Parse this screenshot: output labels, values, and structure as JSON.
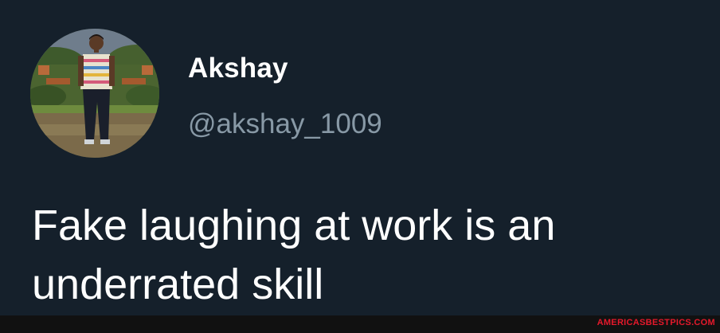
{
  "user": {
    "display_name": "Akshay",
    "handle": "@akshay_1009"
  },
  "tweet": {
    "text": "Fake laughing at work is an underrated skill"
  },
  "watermark": {
    "text": "AMERICASBESTPICS.COM"
  },
  "colors": {
    "background": "#15202b",
    "primary_text": "#ffffff",
    "secondary_text": "#8899a6",
    "watermark": "#e6192b"
  }
}
